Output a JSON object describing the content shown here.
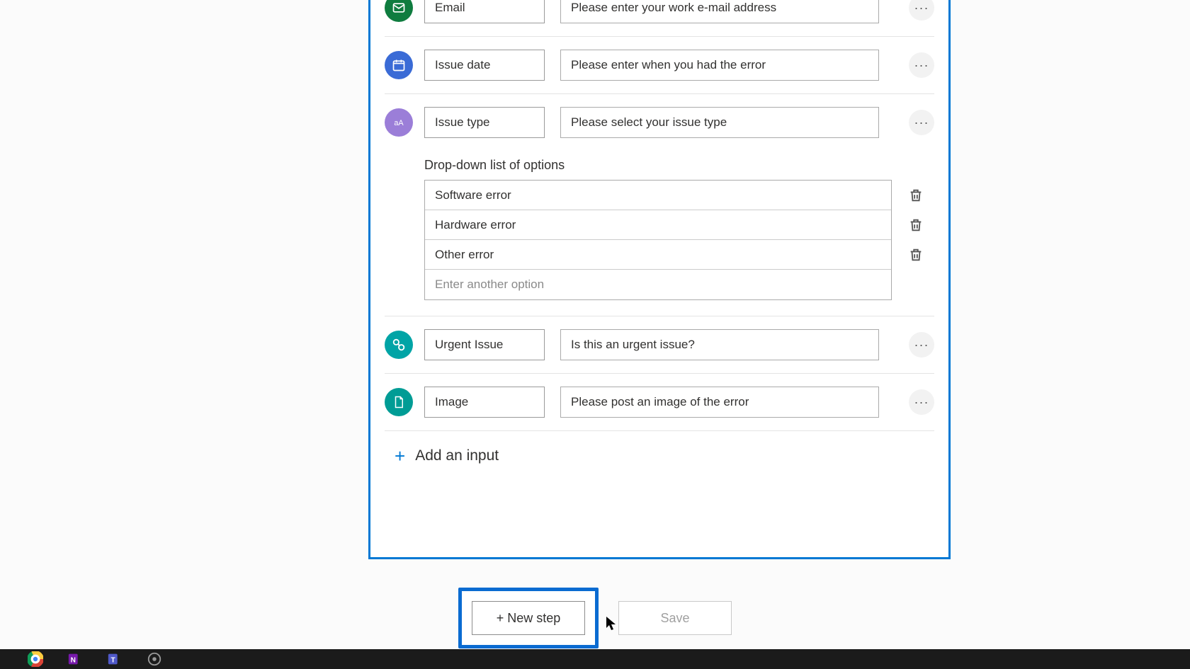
{
  "inputs": {
    "email": {
      "name": "Email",
      "desc": "Please enter your work e-mail address"
    },
    "issueDate": {
      "name": "Issue date",
      "desc": "Please enter when you had the error"
    },
    "issueType": {
      "name": "Issue type",
      "desc": "Please select your issue type"
    },
    "urgent": {
      "name": "Urgent Issue",
      "desc": "Is this an urgent issue?"
    },
    "image": {
      "name": "Image",
      "desc": "Please post an image of the error"
    }
  },
  "dropdown": {
    "label": "Drop-down list of options",
    "options": [
      "Software error",
      "Hardware error",
      "Other error"
    ],
    "placeholder": "Enter another option"
  },
  "addInput": "Add an input",
  "newStep": "+ New step",
  "save": "Save"
}
